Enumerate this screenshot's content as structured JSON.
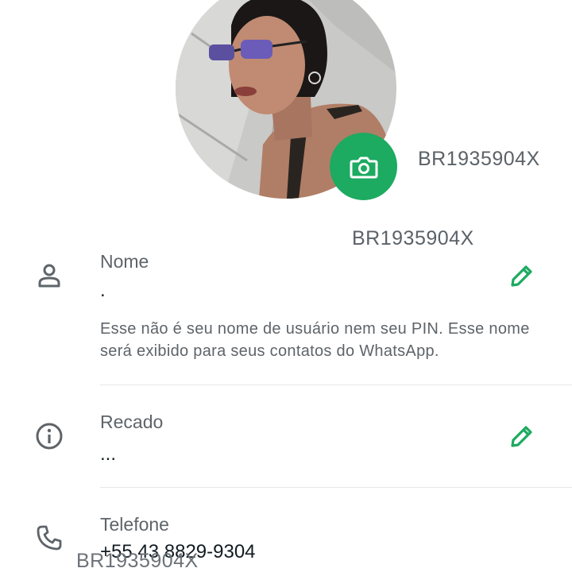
{
  "profile": {
    "photo": "profile-photo",
    "camera_icon": "camera-icon",
    "accent_color": "#1daa61"
  },
  "watermark": "BR1935904X",
  "name_row": {
    "icon": "person-icon",
    "label": "Nome",
    "value": ".",
    "helper": "Esse não é seu nome de usuário nem seu PIN. Esse nome será exibido para seus contatos do WhatsApp.",
    "edit_icon": "pencil-icon"
  },
  "about_row": {
    "icon": "info-icon",
    "label": "Recado",
    "value": "...",
    "edit_icon": "pencil-icon"
  },
  "phone_row": {
    "icon": "phone-icon",
    "label": "Telefone",
    "value": "+55 43 8829-9304"
  }
}
